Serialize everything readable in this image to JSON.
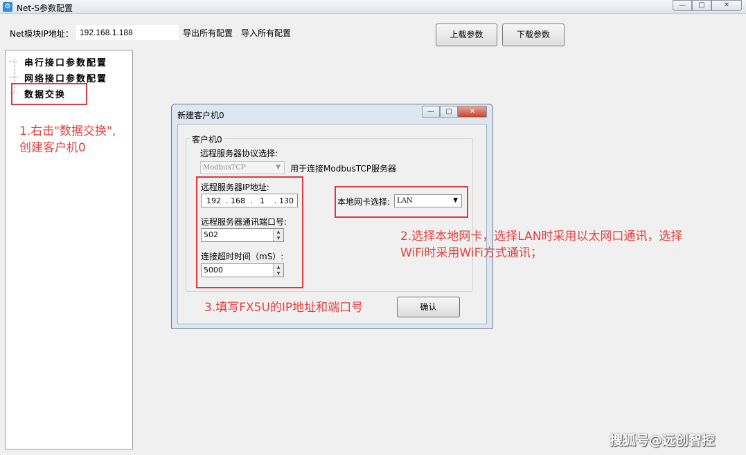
{
  "window": {
    "title": "Net-S参数配置",
    "app_icon": "gear-icon",
    "controls": {
      "minimize": "—",
      "maximize": "□",
      "close": "✕"
    }
  },
  "toolbar": {
    "ip_label": "Net模块IP地址：",
    "ip_value": "192.168.1.188",
    "export_all": "导出所有配置",
    "import_all": "导入所有配置",
    "upload_params": "上载参数",
    "download_params": "下载参数"
  },
  "tree": {
    "items": [
      {
        "label": "串行接口参数配置"
      },
      {
        "label": "网络接口参数配置"
      },
      {
        "label": "数据交换"
      }
    ]
  },
  "dialog": {
    "title": "新建客户机0",
    "controls": {
      "minimize": "—",
      "maximize": "□",
      "close": "✕"
    },
    "group_title": "客户机0",
    "protocol_label": "远程服务器协议选择:",
    "protocol_value": "ModbusTCP",
    "protocol_desc": "用于连接ModbusTCP服务器",
    "server_ip_label": "远程服务器IP地址:",
    "server_ip": [
      "192",
      "168",
      "1",
      "130"
    ],
    "ip_dot": ".",
    "port_label": "远程服务器通讯端口号:",
    "port_value": "502",
    "timeout_label": "连接超时时间（mS）:",
    "timeout_value": "5000",
    "nic_label": "本地网卡选择:",
    "nic_value": "LAN",
    "confirm": "确认"
  },
  "annotations": {
    "step1_line1": "1.右击\"数据交换\",",
    "step1_line2": "创建客户机0",
    "step2_line1": "2.选择本地网卡，选择LAN时采用以太网口通讯，选择",
    "step2_line2": "WiFi时采用WiFi方式通讯；",
    "step3": "3.填写FX5U的IP地址和端口号"
  },
  "colors": {
    "annotation": "#e5403e"
  },
  "watermark": "搜狐号@远创智控"
}
